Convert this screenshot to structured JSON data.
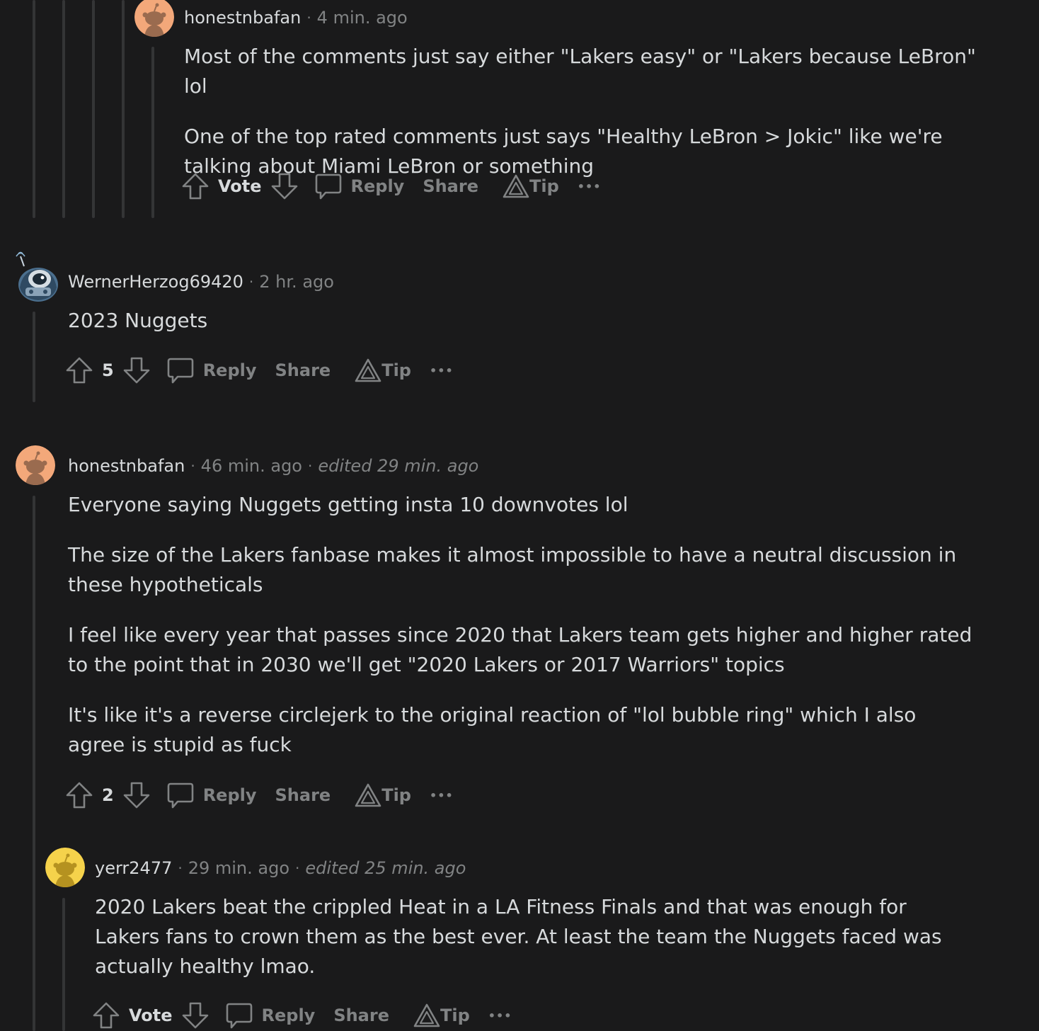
{
  "actions": {
    "reply": "Reply",
    "share": "Share",
    "tip": "Tip",
    "more": "•••"
  },
  "comments": [
    {
      "author": "honestnbafan",
      "time": "4 min. ago",
      "edited": "",
      "paragraphs": [
        "Most of the comments just say either \"Lakers easy\" or \"Lakers because LeBron\" lol",
        "One of the top rated comments just says \"Healthy LeBron > Jokic\" like we're talking about Miami LeBron or something"
      ],
      "score": "Vote"
    },
    {
      "author": "WernerHerzog69420",
      "time": "2 hr. ago",
      "edited": "",
      "paragraphs": [
        "2023 Nuggets"
      ],
      "score": "5"
    },
    {
      "author": "honestnbafan",
      "time": "46 min. ago",
      "edited": "edited 29 min. ago",
      "paragraphs": [
        "Everyone saying Nuggets getting insta 10 downvotes lol",
        "The size of the Lakers fanbase makes it almost impossible to have a neutral discussion in these hypotheticals",
        "I feel like every year that passes since 2020 that Lakers team gets higher and higher rated to the point that in 2030 we'll get \"2020 Lakers or 2017 Warriors\" topics",
        "It's like it's a reverse circlejerk to the original reaction of \"lol bubble ring\" which I also agree is stupid as fuck"
      ],
      "score": "2"
    },
    {
      "author": "yerr2477",
      "time": "29 min. ago",
      "edited": "edited 25 min. ago",
      "paragraphs": [
        "2020 Lakers beat the crippled Heat in a LA Fitness Finals and that was enough for Lakers fans to crown them as the best ever. At least the team the Nuggets faced was actually healthy lmao."
      ],
      "score": "Vote"
    }
  ],
  "colors": {
    "background": "#1a1a1b",
    "text": "#d7dadc",
    "muted": "#818384",
    "thread_line": "#343536",
    "snoo_orange": "#f3a87a",
    "snoo_yellow": "#f5d24b"
  }
}
